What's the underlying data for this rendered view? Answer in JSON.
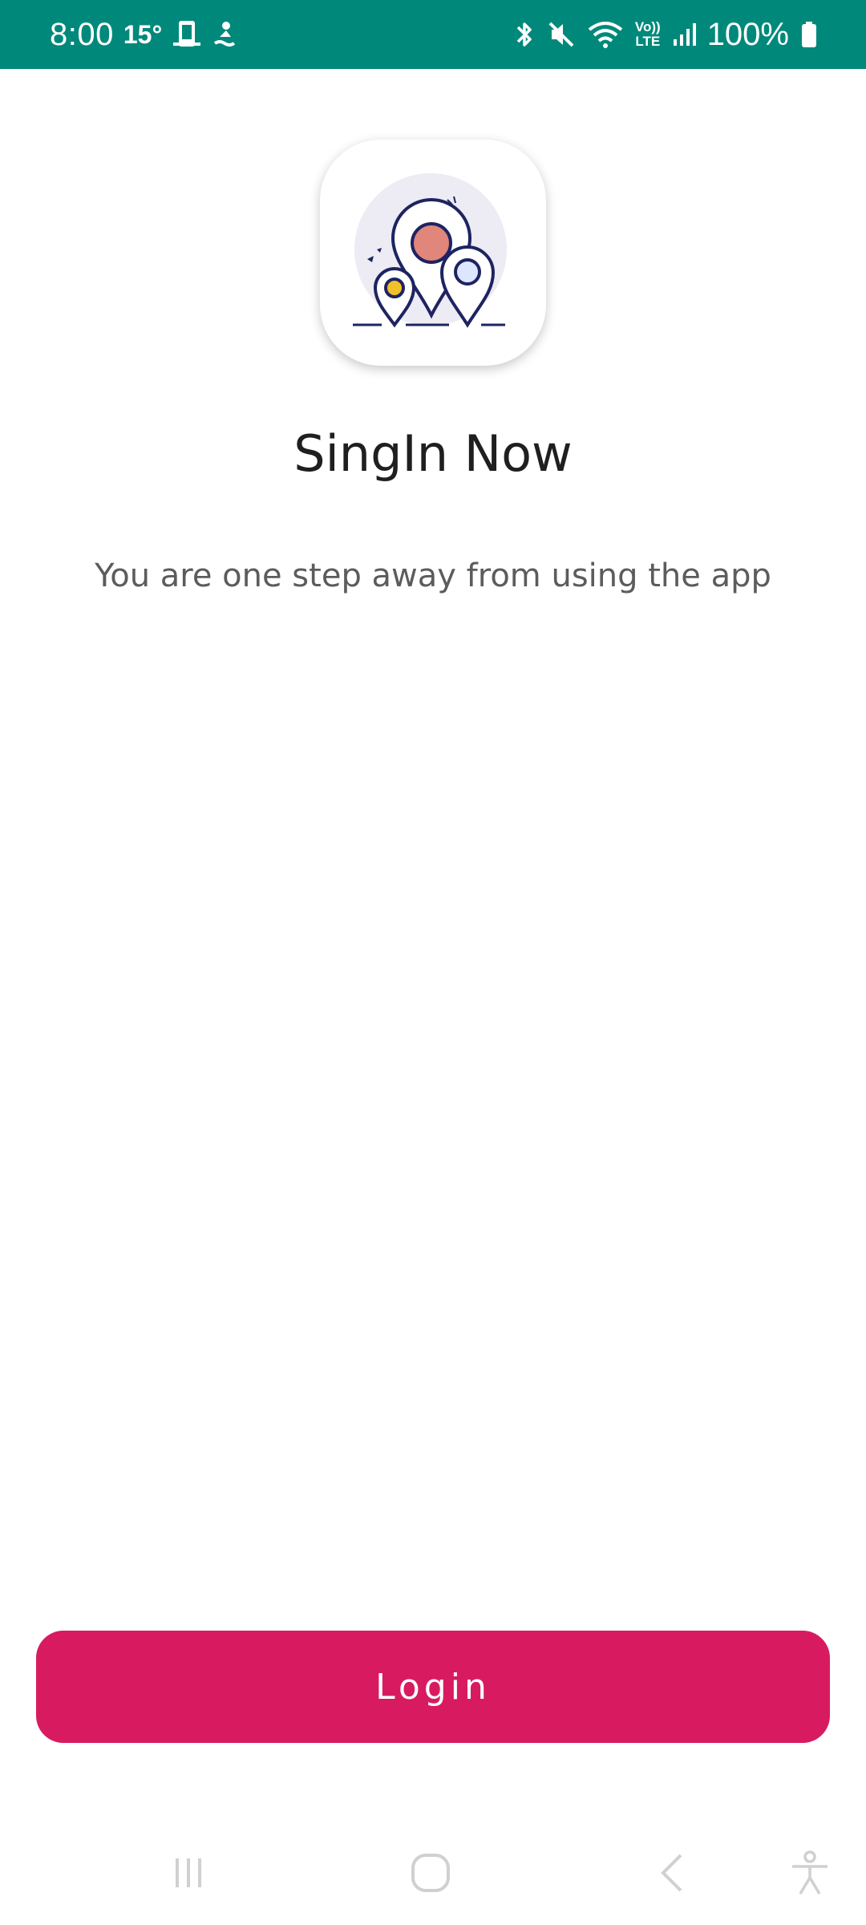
{
  "status_bar": {
    "time": "8:00",
    "temperature": "15°",
    "battery": "100%",
    "background_color": "#00897B",
    "icons_left": [
      "phone-screen-icon",
      "swimmer-icon"
    ],
    "icons_right": [
      "bluetooth-icon",
      "mute-icon",
      "wifi-icon",
      "volte-icon",
      "signal-icon",
      "battery-icon"
    ],
    "volte_label_top": "Vo))",
    "volte_label_bottom": "LTE"
  },
  "app_icon": {
    "name": "location-pins-logo"
  },
  "main": {
    "title": "SingIn Now",
    "subtitle": "You are one step away from using the app"
  },
  "login_button": {
    "label": "Login",
    "color": "#D81B60"
  },
  "nav_bar": {
    "buttons": [
      "recent-apps-icon",
      "home-icon",
      "back-icon",
      "accessibility-icon"
    ]
  }
}
